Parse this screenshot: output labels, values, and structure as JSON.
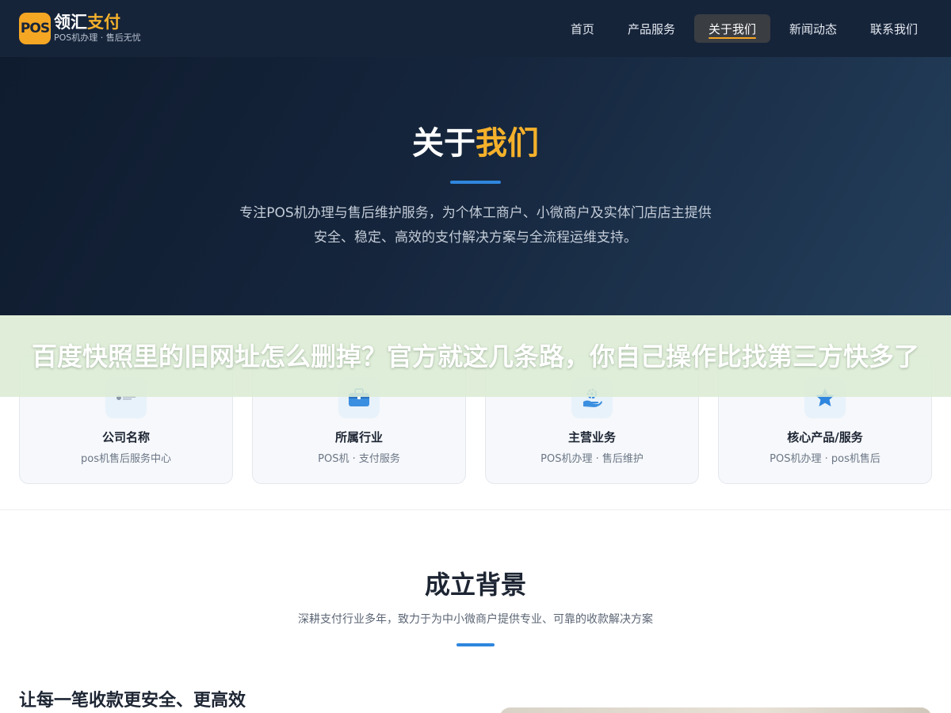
{
  "header": {
    "logo_mark": "POS",
    "brand_name_part1": "领汇",
    "brand_name_part2": "支付",
    "brand_sub": "POS机办理 · 售后无忧",
    "nav": [
      {
        "label": "首页",
        "active": false
      },
      {
        "label": "产品服务",
        "active": false
      },
      {
        "label": "关于我们",
        "active": true
      },
      {
        "label": "新闻动态",
        "active": false
      },
      {
        "label": "联系我们",
        "active": false
      }
    ]
  },
  "hero": {
    "title_part1": "关于",
    "title_part2": "我们",
    "desc_line1": "专注POS机办理与售后维护服务，为个体工商户、小微商户及实体门店店主提供",
    "desc_line2": "安全、稳定、高效的支付解决方案与全流程运维支持。"
  },
  "overlay": {
    "text": "百度快照里的旧网址怎么删掉？官方就这几条路，你自己操作比找第三方快多了"
  },
  "info_cards": [
    {
      "icon": "company-logo-icon",
      "label": "公司名称",
      "value": "pos机售后服务中心"
    },
    {
      "icon": "briefcase-icon",
      "label": "所属行业",
      "value": "POS机 · 支付服务"
    },
    {
      "icon": "gear-hand-icon",
      "label": "主营业务",
      "value": "POS机办理 · 售后维护"
    },
    {
      "icon": "star-icon",
      "label": "核心产品/服务",
      "value": "POS机办理 · pos机售后"
    }
  ],
  "background_section": {
    "title": "成立背景",
    "desc": "深耕支付行业多年，致力于为中小微商户提供专业、可靠的收款解决方案",
    "heading": "让每一笔收款更安全、更高效"
  },
  "colors": {
    "header_bg": "#16243a",
    "accent_gold": "#f5b12b",
    "accent_blue": "#2f86de"
  }
}
